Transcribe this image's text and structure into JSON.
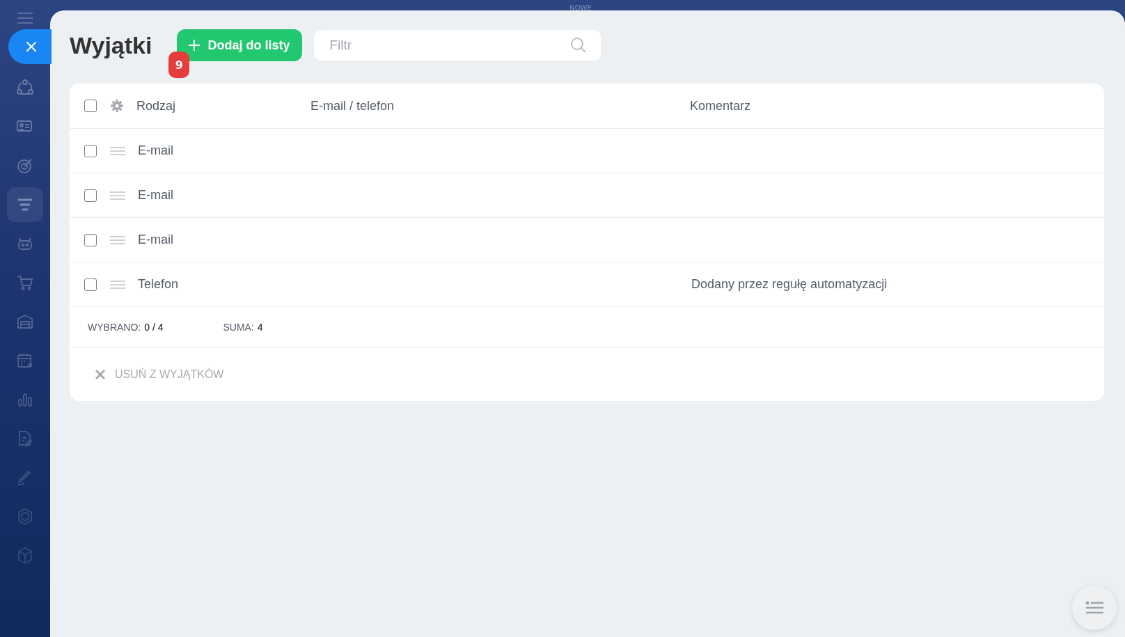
{
  "background": {
    "label": "NOWE"
  },
  "sidebar": {
    "items": [
      {
        "selected": false
      },
      {
        "selected": false
      },
      {
        "selected": false
      },
      {
        "selected": true
      },
      {
        "selected": false
      },
      {
        "selected": false
      },
      {
        "selected": false
      },
      {
        "selected": false
      },
      {
        "selected": false
      },
      {
        "selected": false
      },
      {
        "selected": false
      },
      {
        "selected": false
      },
      {
        "selected": false
      }
    ]
  },
  "header": {
    "title": "Wyjątki",
    "add_button": "Dodaj do listy",
    "badge": "9",
    "filter": {
      "placeholder": "Filtr"
    }
  },
  "table": {
    "columns": [
      "Rodzaj",
      "E-mail / telefon",
      "Komentarz"
    ],
    "rows": [
      {
        "checked": false,
        "type": "E-mail",
        "contact": "",
        "comment": ""
      },
      {
        "checked": false,
        "type": "E-mail",
        "contact": "",
        "comment": ""
      },
      {
        "checked": false,
        "type": "E-mail",
        "contact": "",
        "comment": ""
      },
      {
        "checked": false,
        "type": "Telefon",
        "contact": "",
        "comment": "Dodany przez regułę automatyzacji"
      }
    ],
    "all_checked": false,
    "footer": {
      "selected_label": "WYBRANO:",
      "selected_value": "0 / 4",
      "total_label": "SUMA:",
      "total_value": "4"
    },
    "action": "USUŃ Z WYJĄTKÓW"
  }
}
